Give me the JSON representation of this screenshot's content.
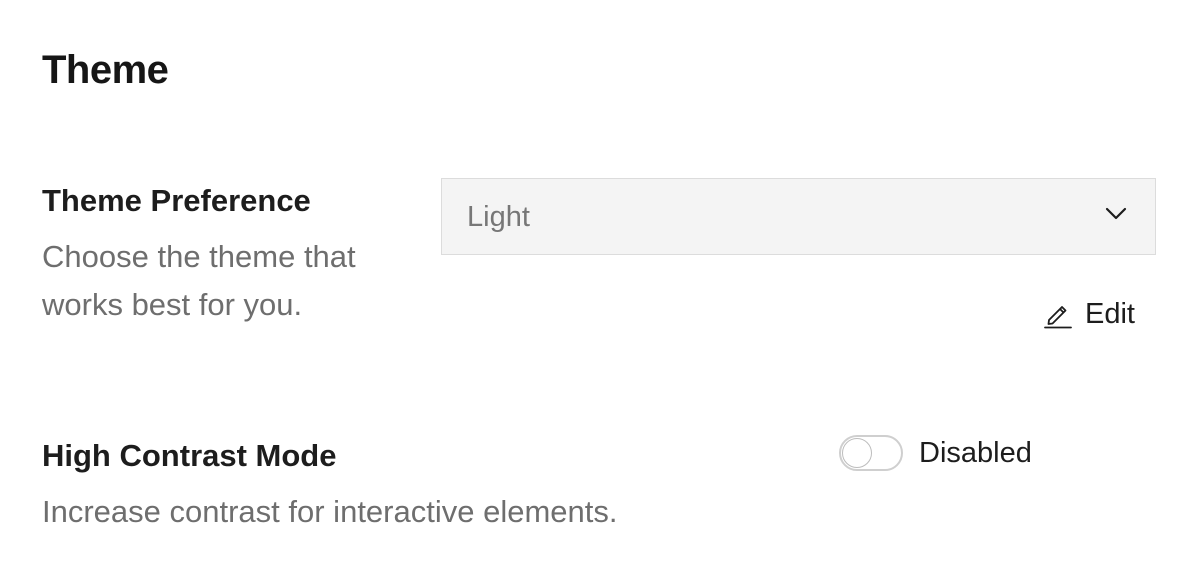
{
  "page": {
    "title": "Theme"
  },
  "theme_preference": {
    "label": "Theme Preference",
    "description": "Choose the theme that works best for you.",
    "selected_value": "Light",
    "dropdown_icon": "chevron-down-icon",
    "edit_label": "Edit",
    "edit_icon": "pencil-icon"
  },
  "high_contrast": {
    "label": "High Contrast Mode",
    "description": "Increase contrast for interactive elements.",
    "state_label": "Disabled",
    "enabled": false
  },
  "colors": {
    "text_primary": "#1d1d1d",
    "text_secondary": "#6e6e6e",
    "select_background": "#f4f4f4",
    "toggle_border": "#cfcfcf"
  }
}
